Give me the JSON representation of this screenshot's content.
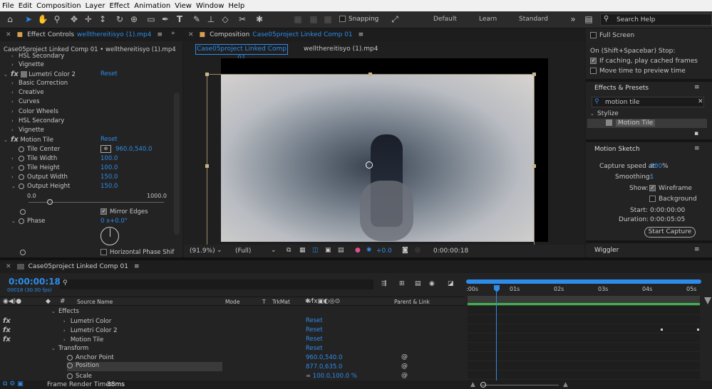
{
  "menu": [
    "File",
    "Edit",
    "Composition",
    "Layer",
    "Effect",
    "Animation",
    "View",
    "Window",
    "Help"
  ],
  "toolbar": {
    "snapping": "Snapping",
    "workspaces": [
      "Default",
      "Learn",
      "Standard"
    ],
    "search_help": "Search Help"
  },
  "effect_controls": {
    "tab": "Effect Controls",
    "tab_file": "wellthereitisyo (1).mp4",
    "subtitle": "Case05project Linked Comp 01 • wellthereitisyo (1).mp4",
    "rows": {
      "hsl_secondary_top": "HSL Secondary",
      "vignette_top": "Vignette",
      "lumetri2": "Lumetri Color 2",
      "reset": "Reset",
      "basic_correction": "Basic Correction",
      "creative": "Creative",
      "curves": "Curves",
      "color_wheels": "Color Wheels",
      "hsl_secondary": "HSL Secondary",
      "vignette": "Vignette",
      "motion_tile": "Motion Tile",
      "tile_center": "Tile Center",
      "tile_center_val": "960.0,540.0",
      "tile_width": "Tile Width",
      "tile_width_val": "100.0",
      "tile_height": "Tile Height",
      "tile_height_val": "100.0",
      "output_width": "Output Width",
      "output_width_val": "150.0",
      "output_height": "Output Height",
      "output_height_val": "150.0",
      "slider_min": "0.0",
      "slider_max": "1000.0",
      "mirror_edges": "Mirror Edges",
      "phase": "Phase",
      "phase_val": "0 x+0.0°",
      "horizontal_phase": "Horizontal Phase Shif"
    }
  },
  "composition": {
    "tab": "Composition",
    "tab_name": "Case05project Linked Comp 01",
    "subtabs": [
      "Case05project Linked Comp 01",
      "wellthereitisyo (1).mp4"
    ],
    "zoom": "(91.9%)",
    "resolution": "(Full)",
    "exposure": "+0.0",
    "timecode": "0:00:00:18"
  },
  "preview": {
    "full_screen": "Full Screen",
    "on_spacebar": "On (Shift+Spacebar) Stop:",
    "if_caching": "If caching, play cached frames",
    "move_time": "Move time to preview time"
  },
  "effects_presets": {
    "title": "Effects & Presets",
    "search": "motion tile",
    "category": "Stylize",
    "item": "Motion Tile"
  },
  "motion_sketch": {
    "title": "Motion Sketch",
    "capture_label": "Capture speed at:",
    "capture_val": "100",
    "capture_unit": "%",
    "smoothing_label": "Smoothing:",
    "smoothing_val": "1",
    "show_label": "Show:",
    "wireframe": "Wireframe",
    "background": "Background",
    "start_label": "Start:",
    "start_val": "0:00:00:00",
    "duration_label": "Duration:",
    "duration_val": "0:00:05:05",
    "button": "Start Capture"
  },
  "wiggler": {
    "title": "Wiggler"
  },
  "timeline": {
    "tab": "Case05project Linked Comp 01",
    "timecode": "0:00:00:18",
    "fps": "00018 (30.00 fps)",
    "headers": {
      "source": "Source Name",
      "mode": "Mode",
      "t": "T",
      "trkmat": "TrkMat",
      "parent": "Parent & Link"
    },
    "rows": [
      {
        "name": "Effects",
        "val": ""
      },
      {
        "name": "Lumetri Color",
        "val": "Reset"
      },
      {
        "name": "Lumetri Color 2",
        "val": "Reset"
      },
      {
        "name": "Motion Tile",
        "val": "Reset"
      },
      {
        "name": "Transform",
        "val": "Reset"
      },
      {
        "name": "Anchor Point",
        "val": "960.0,540.0"
      },
      {
        "name": "Position",
        "val": "877.0,635.0"
      },
      {
        "name": "Scale",
        "val": "100.0,100.0 %"
      }
    ],
    "ruler": [
      "0s",
      "01s",
      "02s",
      "03s",
      "04s",
      "05s"
    ],
    "ruler_first": ":00s",
    "footer": "Frame Render Time:",
    "render_time": "38ms"
  }
}
